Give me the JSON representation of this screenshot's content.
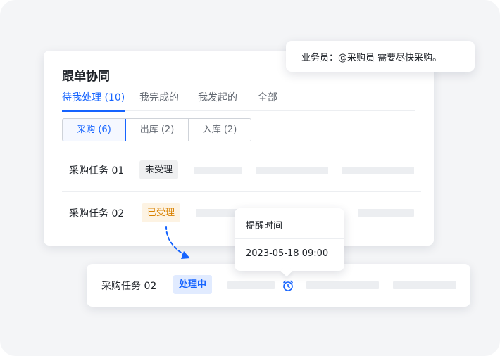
{
  "message": {
    "text": "业务员：@采购员 需要尽快采购。"
  },
  "panel": {
    "title": "跟单协同",
    "tabs": [
      {
        "label": "待我处理 (10)",
        "active": true
      },
      {
        "label": "我完成的",
        "active": false
      },
      {
        "label": "我发起的",
        "active": false
      },
      {
        "label": "全部",
        "active": false
      }
    ],
    "filters": [
      {
        "label": "采购 (6)",
        "active": true
      },
      {
        "label": "出库 (2)",
        "active": false
      },
      {
        "label": "入库 (2)",
        "active": false
      }
    ],
    "tasks": [
      {
        "name": "采购任务 01",
        "status": "未受理"
      },
      {
        "name": "采购任务 02",
        "status": "已受理"
      }
    ]
  },
  "tooltip": {
    "title": "提醒时间",
    "time": "2023-05-18 09:00"
  },
  "detail_task": {
    "name": "采购任务 02",
    "status": "处理中",
    "icon": "alarm-clock-icon"
  },
  "colors": {
    "accent": "#1664ff",
    "pending_orange": "#d88100",
    "neutral_bar": "#eceef1"
  }
}
